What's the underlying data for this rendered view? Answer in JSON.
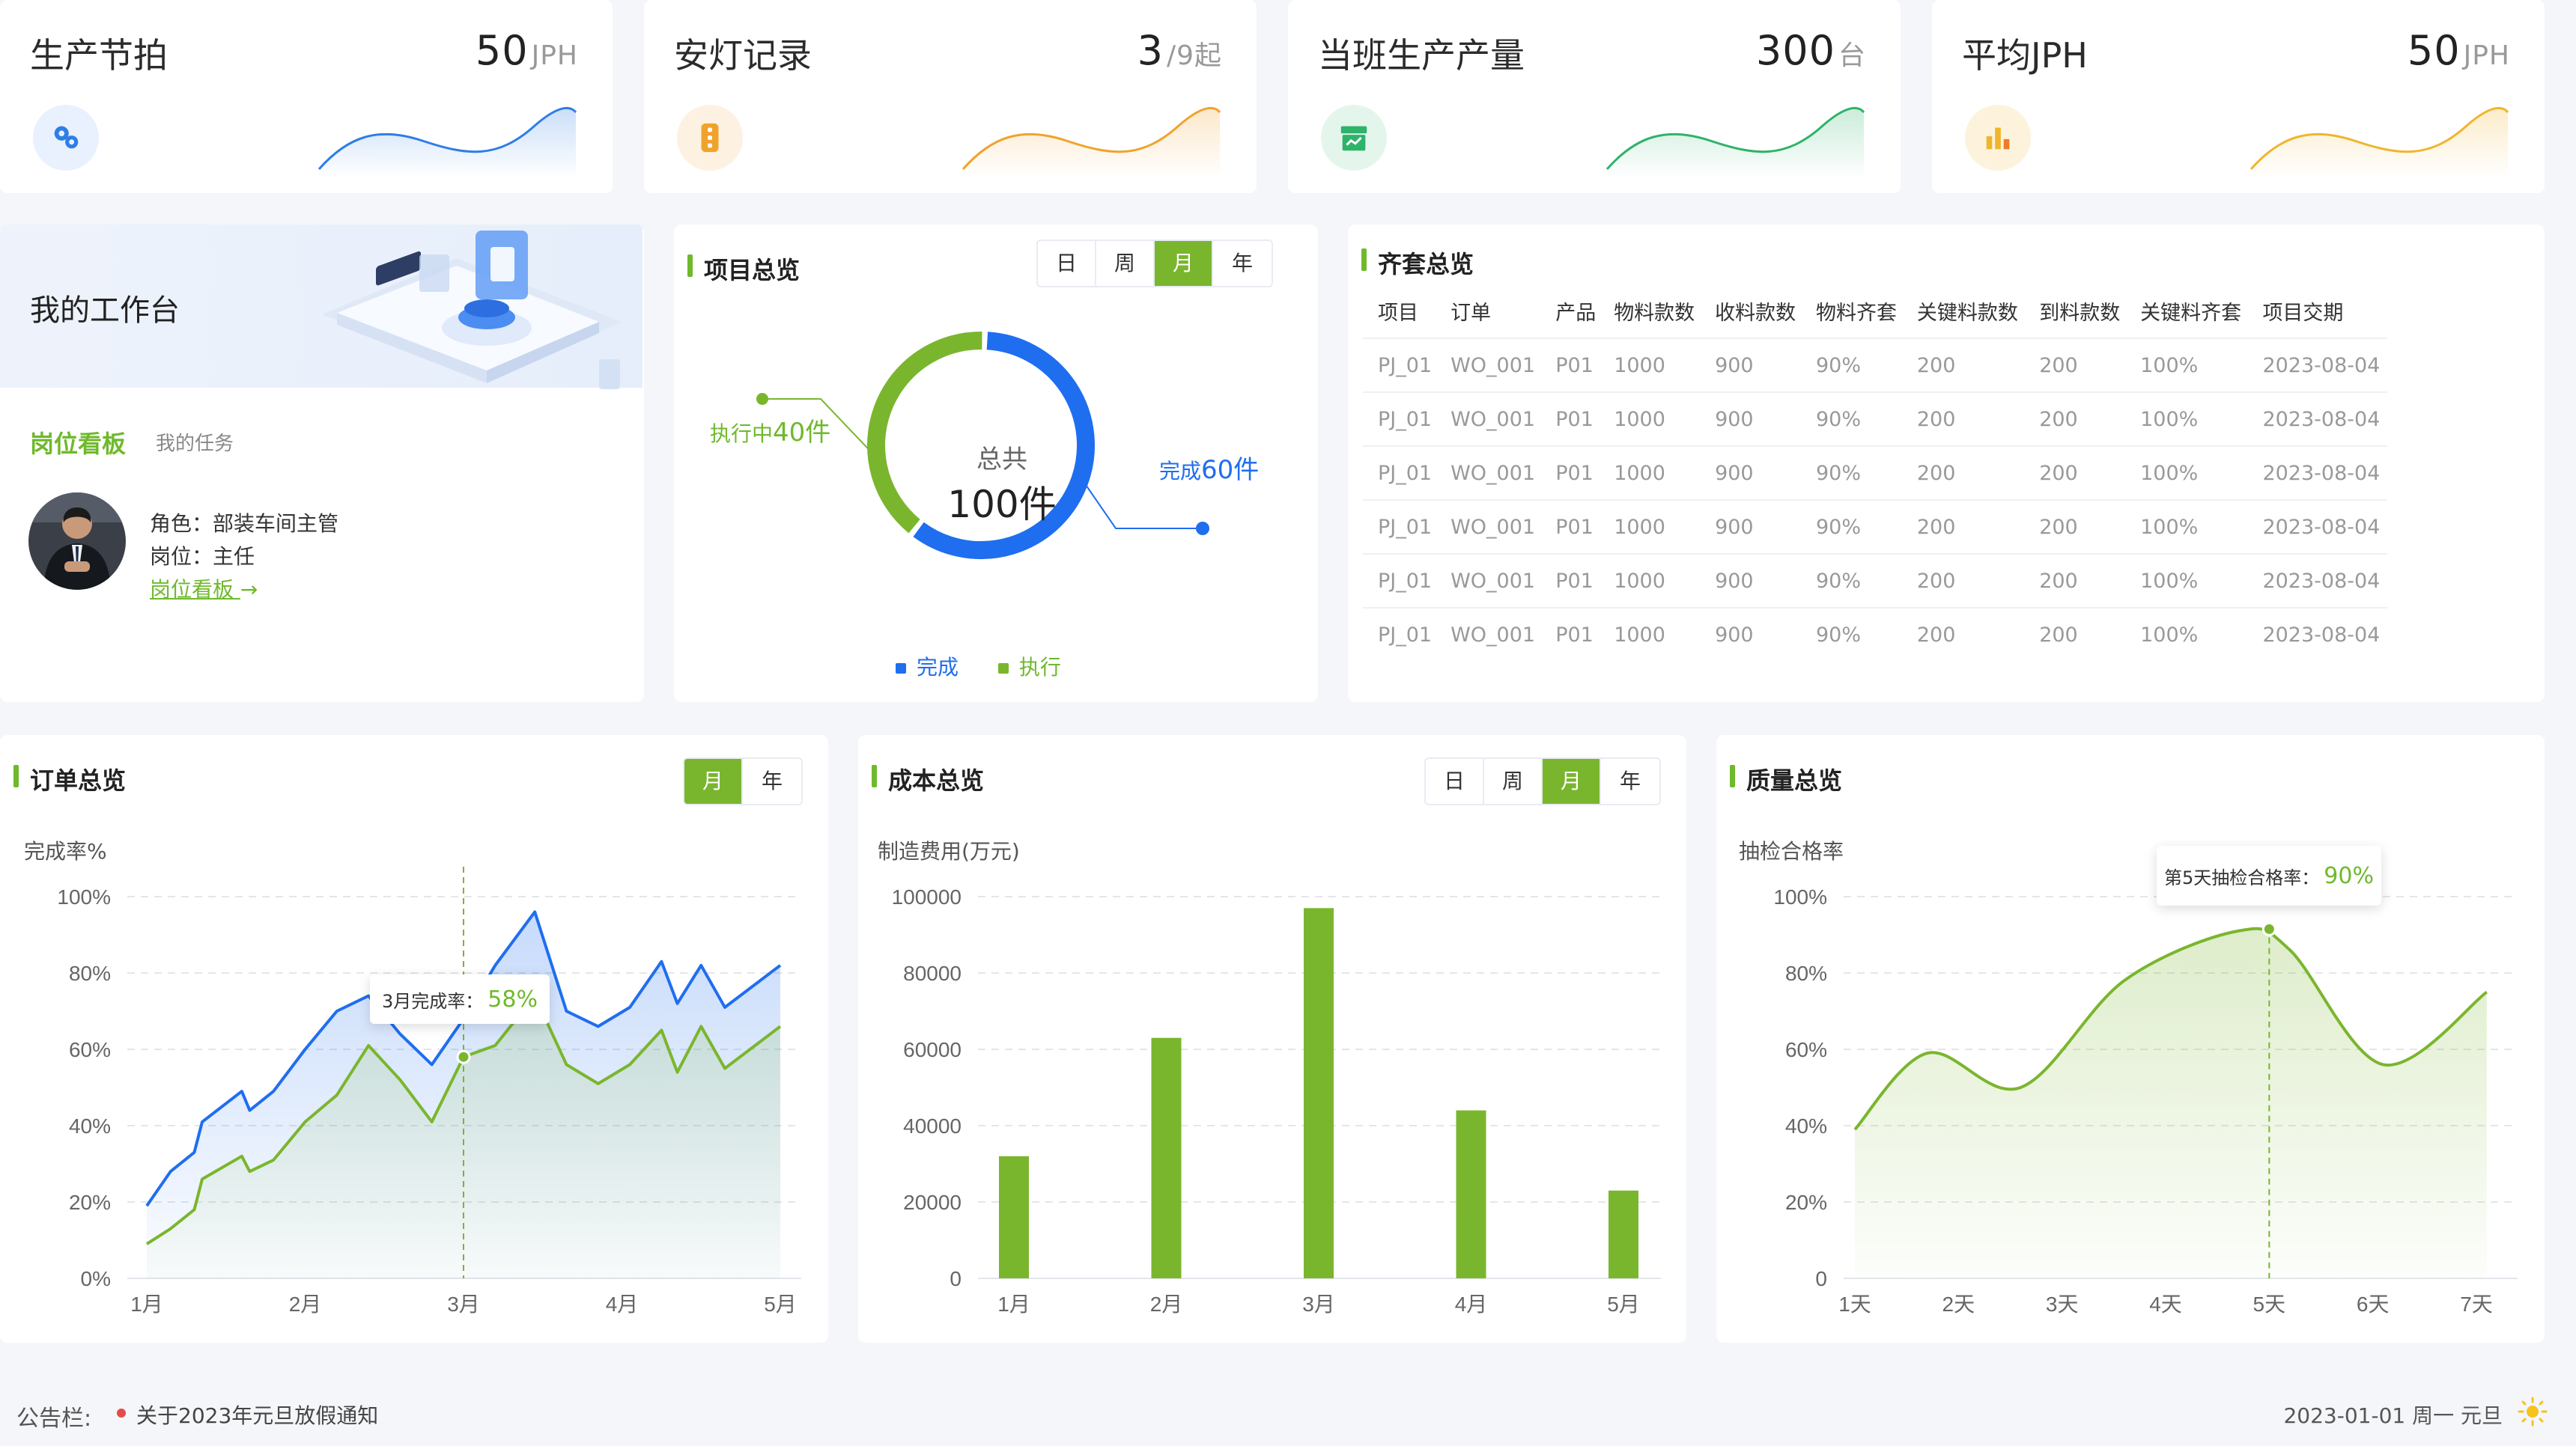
{
  "kpis": [
    {
      "title": "生产节拍",
      "value": "50",
      "unit": "JPH",
      "icon": "gears-icon",
      "color": "#2e7ee6",
      "bg": "#e8f1fd"
    },
    {
      "title": "安灯记录",
      "value": "3",
      "unit": "/9起",
      "icon": "andon-icon",
      "color": "#f0a32c",
      "bg": "#fdf2e2"
    },
    {
      "title": "当班生产产量",
      "value": "300",
      "unit": "台",
      "icon": "box-icon",
      "color": "#2eb36a",
      "bg": "#e4f6ec"
    },
    {
      "title": "平均JPH",
      "value": "50",
      "unit": "JPH",
      "icon": "bar-chart-icon",
      "color": "#f0b52c",
      "bg": "#fdf3dd"
    }
  ],
  "workbench": {
    "title": "我的工作台",
    "tab_active": "岗位看板",
    "tab_other": "我的任务",
    "role": "角色：部装车间主管",
    "post": "岗位：主任",
    "link": "岗位看板"
  },
  "project": {
    "title": "项目总览",
    "periods": [
      "日",
      "周",
      "月",
      "年"
    ],
    "active_period": "月",
    "center_label": "总共",
    "center_value": "100件",
    "exec_label": "执行中",
    "exec_value": "40件",
    "done_label": "完成",
    "done_value": "60件",
    "legend": [
      "完成",
      "执行"
    ],
    "chart_data": {
      "type": "pie",
      "categories": [
        "完成",
        "执行"
      ],
      "values": [
        60,
        40
      ],
      "colors": [
        "#1f6ef0",
        "#7ab62d"
      ]
    }
  },
  "kitting": {
    "title": "齐套总览",
    "columns": [
      "项目",
      "订单",
      "产品",
      "物料款数",
      "收料款数",
      "物料齐套",
      "关键料款数",
      "到料款数",
      "关键料齐套",
      "项目交期"
    ],
    "rows": [
      [
        "PJ_01",
        "WO_001",
        "P01",
        "1000",
        "900",
        "90%",
        "200",
        "200",
        "100%",
        "2023-08-04"
      ],
      [
        "PJ_01",
        "WO_001",
        "P01",
        "1000",
        "900",
        "90%",
        "200",
        "200",
        "100%",
        "2023-08-04"
      ],
      [
        "PJ_01",
        "WO_001",
        "P01",
        "1000",
        "900",
        "90%",
        "200",
        "200",
        "100%",
        "2023-08-04"
      ],
      [
        "PJ_01",
        "WO_001",
        "P01",
        "1000",
        "900",
        "90%",
        "200",
        "200",
        "100%",
        "2023-08-04"
      ],
      [
        "PJ_01",
        "WO_001",
        "P01",
        "1000",
        "900",
        "90%",
        "200",
        "200",
        "100%",
        "2023-08-04"
      ],
      [
        "PJ_01",
        "WO_001",
        "P01",
        "1000",
        "900",
        "90%",
        "200",
        "200",
        "100%",
        "2023-08-04"
      ]
    ]
  },
  "orders": {
    "title": "订单总览",
    "periods": [
      "月",
      "年"
    ],
    "active_period": "月",
    "ylabel": "完成率%",
    "tooltip_label": "3月完成率：",
    "tooltip_value": "58%",
    "chart_data": {
      "type": "area",
      "x_ticks": [
        "1月",
        "2月",
        "3月",
        "4月",
        "5月"
      ],
      "y_ticks": [
        "0%",
        "20%",
        "40%",
        "60%",
        "80%",
        "100%"
      ],
      "ylim": [
        0,
        100
      ],
      "x": [
        1,
        1.15,
        1.3,
        1.35,
        1.6,
        1.65,
        1.8,
        2.0,
        2.2,
        2.4,
        2.6,
        2.8,
        3.0,
        3.2,
        3.45,
        3.65,
        3.85,
        4.05,
        4.25,
        4.35,
        4.5,
        4.65,
        5.0
      ],
      "series": [
        {
          "color": "#1f6ef0",
          "values": [
            19,
            28,
            33,
            41,
            49,
            44,
            49,
            60,
            70,
            74,
            64,
            56,
            68,
            82,
            96,
            70,
            66,
            71,
            83,
            72,
            82,
            71,
            82
          ]
        },
        {
          "color": "#7ab62d",
          "values": [
            9,
            13,
            18,
            26,
            32,
            28,
            31,
            41,
            48,
            61,
            52,
            41,
            58,
            61,
            74,
            56,
            51,
            56,
            65,
            54,
            66,
            55,
            66
          ]
        }
      ],
      "highlight_x": 3.0
    }
  },
  "cost": {
    "title": "成本总览",
    "periods": [
      "日",
      "周",
      "月",
      "年"
    ],
    "active_period": "月",
    "ylabel": "制造费用(万元)",
    "chart_data": {
      "type": "bar",
      "categories": [
        "1月",
        "2月",
        "3月",
        "4月",
        "5月"
      ],
      "values": [
        32000,
        63000,
        97000,
        44000,
        23000
      ],
      "y_ticks": [
        "0",
        "20000",
        "40000",
        "60000",
        "80000",
        "100000"
      ],
      "ylim": [
        0,
        100000
      ],
      "color": "#7ab62d"
    }
  },
  "quality": {
    "title": "质量总览",
    "ylabel": "抽检合格率",
    "tooltip_label": "第5天抽检合格率：",
    "tooltip_value": "90%",
    "chart_data": {
      "type": "area",
      "categories": [
        "1天",
        "2天",
        "3天",
        "4天",
        "5天",
        "6天",
        "7天"
      ],
      "x": [
        1,
        1.7,
        2.6,
        3.6,
        4.7,
        5.2,
        6.1,
        7.1
      ],
      "values": [
        39,
        59,
        50,
        78,
        91,
        86,
        56,
        75
      ],
      "y_ticks": [
        "0",
        "20%",
        "40%",
        "60%",
        "80%",
        "100%"
      ],
      "ylim": [
        0,
        100
      ],
      "color": "#7ab62d",
      "highlight_x": 5
    }
  },
  "footer": {
    "label": "公告栏:",
    "notice": "关于2023年元旦放假通知",
    "date": "2023-01-01  周一  元旦"
  }
}
